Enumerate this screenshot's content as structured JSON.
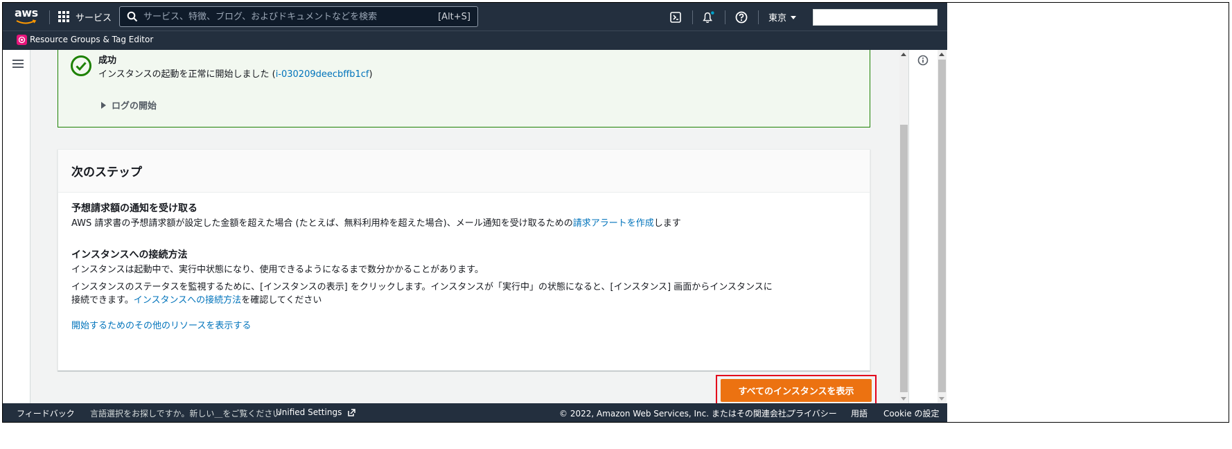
{
  "topnav": {
    "logo_text": "aws",
    "services_label": "サービス",
    "search_placeholder": "サービス、特徴、ブログ、およびドキュメントなどを検索",
    "search_shortcut": "[Alt+S]",
    "region_label": "東京"
  },
  "favorites": {
    "items": [
      {
        "label": "Resource Groups & Tag Editor",
        "color": "#e7157b"
      }
    ]
  },
  "success": {
    "title": "成功",
    "message_prefix": "インスタンスの起動を正常に開始しました (",
    "instance_id": "i-030209deecbffb1cf",
    "message_suffix": ")",
    "log_toggle": "ログの開始"
  },
  "next_steps": {
    "title": "次のステップ",
    "billing": {
      "heading": "予想請求額の通知を受け取る",
      "text_prefix": "AWS 請求書の予想請求額が設定した金額を超えた場合 (たとえば、無料利用枠を超えた場合)、メール通知を受け取るための",
      "link": "請求アラートを作成",
      "text_suffix": "します"
    },
    "connect": {
      "heading": "インスタンスへの接続方法",
      "text1": "インスタンスは起動中で、実行中状態になり、使用できるようになるまで数分かかることがあります。",
      "text2_prefix": "インスタンスのステータスを監視するために、[インスタンスの表示] をクリックします。インスタンスが「実行中」の状態になると、[インスタンス] 画面からインスタンスに接続できます。",
      "text2_link": "インスタンスへの接続方法",
      "text2_suffix": "を確認してください"
    },
    "resources_link": "開始するためのその他のリソースを表示する"
  },
  "primary_button": "すべてのインスタンスを表示",
  "footer": {
    "feedback": "フィードバック",
    "language_prompt": "言語選択をお探しですか。新しい＿をご覧ください",
    "unified_settings": "Unified Settings",
    "copyright": "© 2022, Amazon Web Services, Inc. またはその関連会社。",
    "privacy": "プライバシー",
    "terms": "用語",
    "cookies": "Cookie の設定"
  },
  "colors": {
    "nav_bg": "#232f3e",
    "link": "#0073bb",
    "success_green": "#1d8102",
    "primary_orange": "#ec7211",
    "highlight_red": "#e3001b",
    "notification_dot": "#00a1c9"
  }
}
